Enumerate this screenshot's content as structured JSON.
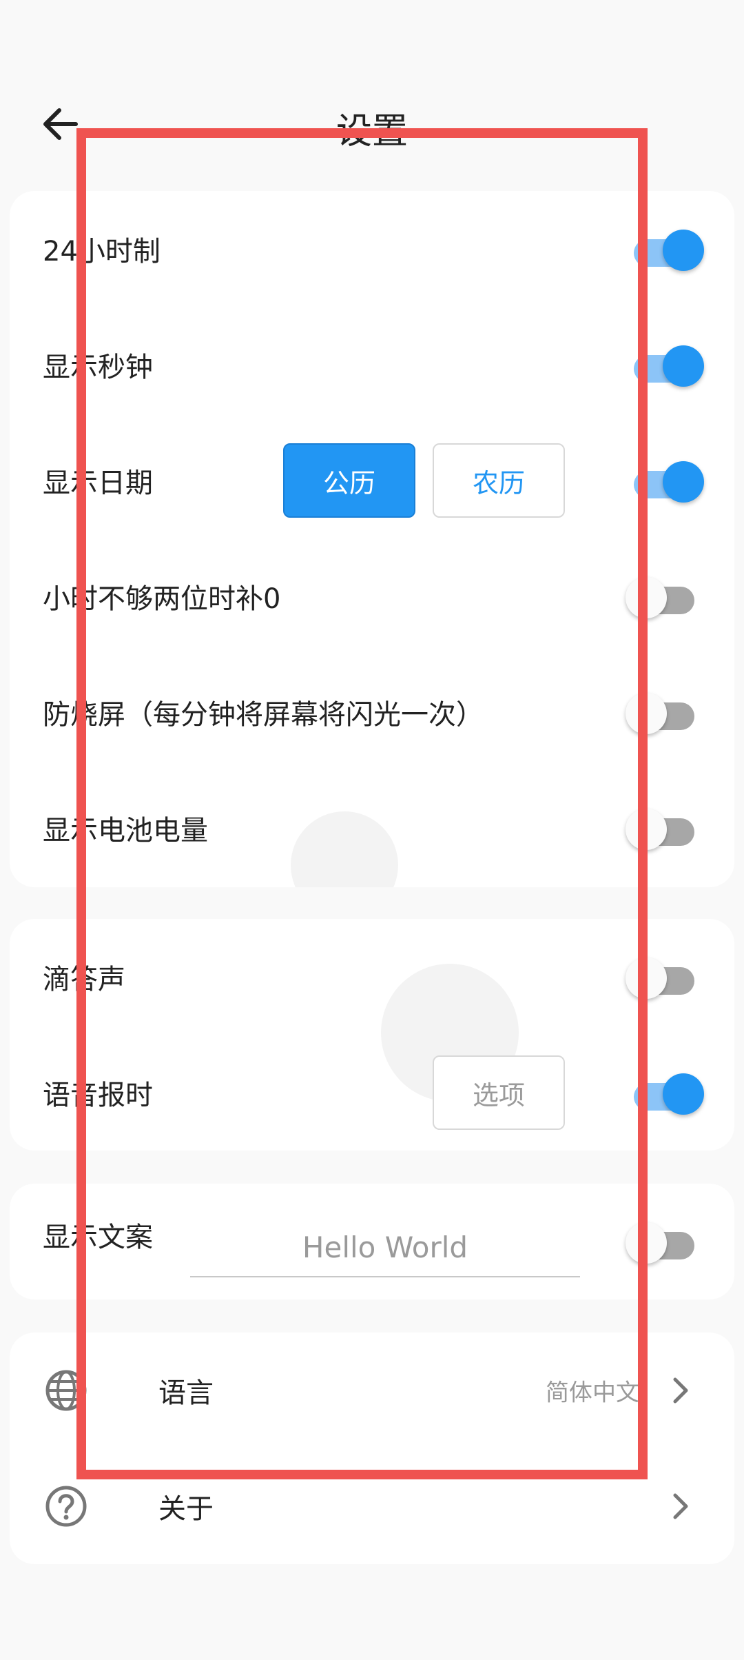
{
  "header": {
    "title": "设置"
  },
  "card1": {
    "rows": [
      {
        "label": "24小时制",
        "toggle": "on"
      },
      {
        "label": "显示秒钟",
        "toggle": "on"
      },
      {
        "label": "显示日期",
        "toggle": "on",
        "buttons": [
          "公历",
          "农历"
        ]
      },
      {
        "label": "小时不够两位时补0",
        "toggle": "off"
      },
      {
        "label": "防烧屏（每分钟将屏幕将闪光一次）",
        "toggle": "off"
      },
      {
        "label": "显示电池电量",
        "toggle": "off"
      }
    ]
  },
  "card2": {
    "rows": [
      {
        "label": "滴答声",
        "toggle": "off"
      },
      {
        "label": "语音报时",
        "toggle": "on",
        "option_label": "选项"
      }
    ]
  },
  "card3": {
    "label": "显示文案",
    "input_value": "Hello World",
    "toggle": "off"
  },
  "card4": {
    "items": [
      {
        "label": "语言",
        "value": "简体中文",
        "icon": "globe-icon"
      },
      {
        "label": "关于",
        "icon": "help-circle-icon"
      }
    ]
  },
  "colors": {
    "accent": "#2296f3",
    "highlight": "#ef5350"
  }
}
